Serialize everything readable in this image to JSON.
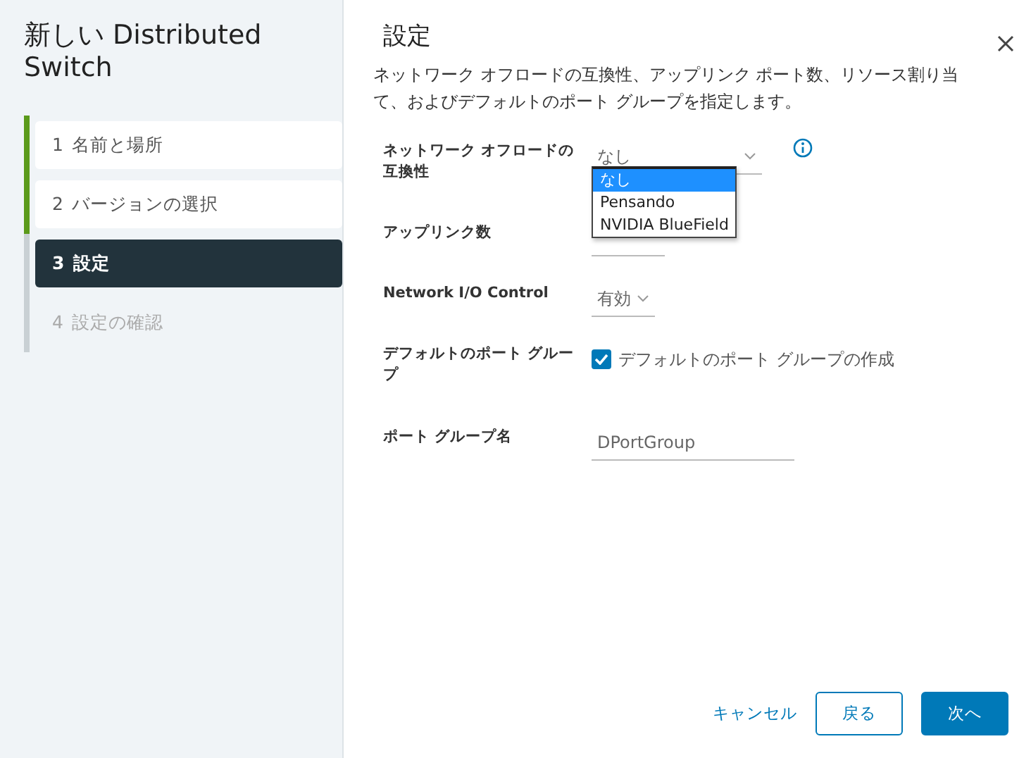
{
  "wizard": {
    "title": "新しい Distributed Switch",
    "steps": [
      {
        "number": "1",
        "label": "名前と場所",
        "completed": true,
        "selected": false
      },
      {
        "number": "2",
        "label": "バージョンの選択",
        "completed": true,
        "selected": false
      },
      {
        "number": "3",
        "label": "設定",
        "completed": false,
        "selected": true
      },
      {
        "number": "4",
        "label": "設定の確認",
        "completed": false,
        "selected": false
      }
    ]
  },
  "page": {
    "title": "設定",
    "description": "ネットワーク オフロードの互換性、アップリンク ポート数、リソース割り当て、およびデフォルトのポート グループを指定します。"
  },
  "form": [
    {
      "kind": "select",
      "label": "ネットワーク オフロードの互換性",
      "value": "なし",
      "info": true,
      "expanded": true,
      "options": [
        {
          "label": "なし",
          "selected": true
        },
        {
          "label": "Pensando",
          "selected": false
        },
        {
          "label": "NVIDIA BlueField",
          "selected": false
        }
      ]
    },
    {
      "kind": "number",
      "label": "アップリンク数"
    },
    {
      "kind": "select",
      "label": "Network I/O Control",
      "value": "有効"
    },
    {
      "kind": "checkbox",
      "label": "デフォルトのポート グループ",
      "text": "デフォルトのポート グループの作成",
      "checked": true
    },
    {
      "kind": "text",
      "label": "ポート グループ名",
      "value": "DPortGroup"
    }
  ],
  "buttons": [
    {
      "label": "キャンセル",
      "kind": "link"
    },
    {
      "label": "戻る",
      "kind": "outline"
    },
    {
      "label": "次へ",
      "kind": "primary"
    }
  ]
}
